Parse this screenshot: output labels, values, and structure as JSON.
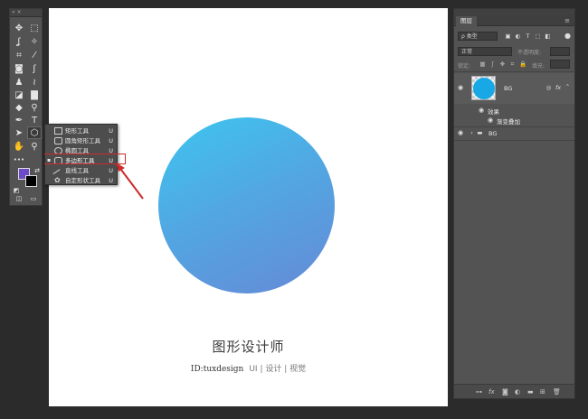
{
  "toolbar": {
    "grip_label": "«  ×",
    "tools": [
      {
        "icon": "move-icon",
        "glyph": "✥"
      },
      {
        "icon": "marquee-icon",
        "glyph": "⬚"
      },
      {
        "icon": "lasso-icon",
        "glyph": "ʆ"
      },
      {
        "icon": "magic-wand-icon",
        "glyph": "✧"
      },
      {
        "icon": "crop-icon",
        "glyph": "⌗"
      },
      {
        "icon": "eyedropper-icon",
        "glyph": "⁄"
      },
      {
        "icon": "healing-brush-icon",
        "glyph": "◙"
      },
      {
        "icon": "brush-icon",
        "glyph": "ʃ"
      },
      {
        "icon": "stamp-icon",
        "glyph": "♟"
      },
      {
        "icon": "history-brush-icon",
        "glyph": "≀"
      },
      {
        "icon": "eraser-icon",
        "glyph": "◪"
      },
      {
        "icon": "gradient-icon",
        "glyph": "▇"
      },
      {
        "icon": "blur-icon",
        "glyph": "◆"
      },
      {
        "icon": "dodge-icon",
        "glyph": "⚲"
      },
      {
        "icon": "pen-icon",
        "glyph": "✒"
      },
      {
        "icon": "type-icon",
        "glyph": "T"
      },
      {
        "icon": "path-select-icon",
        "glyph": "➤"
      },
      {
        "icon": "shape-tool-icon",
        "glyph": "⬡"
      },
      {
        "icon": "hand-icon",
        "glyph": "✋"
      },
      {
        "icon": "zoom-icon",
        "glyph": "⚲"
      },
      {
        "icon": "more-tools-icon",
        "glyph": "•••"
      }
    ],
    "fg_color": "#6d4ac6",
    "bg_color": "#000000"
  },
  "flyout": {
    "items": [
      {
        "label": "矩形工具",
        "key": "U",
        "selected": false
      },
      {
        "label": "圆角矩形工具",
        "key": "U",
        "selected": false
      },
      {
        "label": "椭圆工具",
        "key": "U",
        "selected": false
      },
      {
        "label": "多边形工具",
        "key": "U",
        "selected": true
      },
      {
        "label": "直线工具",
        "key": "U",
        "selected": false
      },
      {
        "label": "自定形状工具",
        "key": "U",
        "selected": false
      }
    ],
    "bullet": "▪"
  },
  "canvas": {
    "title": "图形设计师",
    "id_text": "ID:tuxdesign",
    "tags": "UI | 设计 | 视觉",
    "circle_gradient": [
      "#3dc6ef",
      "#6689d6"
    ],
    "arrow_color": "#cc2b2b"
  },
  "layers_panel": {
    "tab_label": "图层",
    "menu_glyph": "≡",
    "filter_label": "ρ 类型",
    "blend_mode": "正常",
    "opacity_label": "不透明度:",
    "lock_label": "锁定:",
    "fill_label": "填充:",
    "layers": [
      {
        "name": "BG",
        "type": "shape",
        "thumb_color": "#18a8e6"
      },
      {
        "name": "效果",
        "type": "effects"
      },
      {
        "name": "渐变叠加",
        "type": "effect"
      },
      {
        "name": "BG",
        "type": "group"
      }
    ],
    "fx_label": "fx",
    "bottom_icons": [
      "link-icon",
      "fx-icon",
      "mask-icon",
      "adjustment-icon",
      "folder-icon",
      "new-layer-icon",
      "trash-icon"
    ]
  }
}
